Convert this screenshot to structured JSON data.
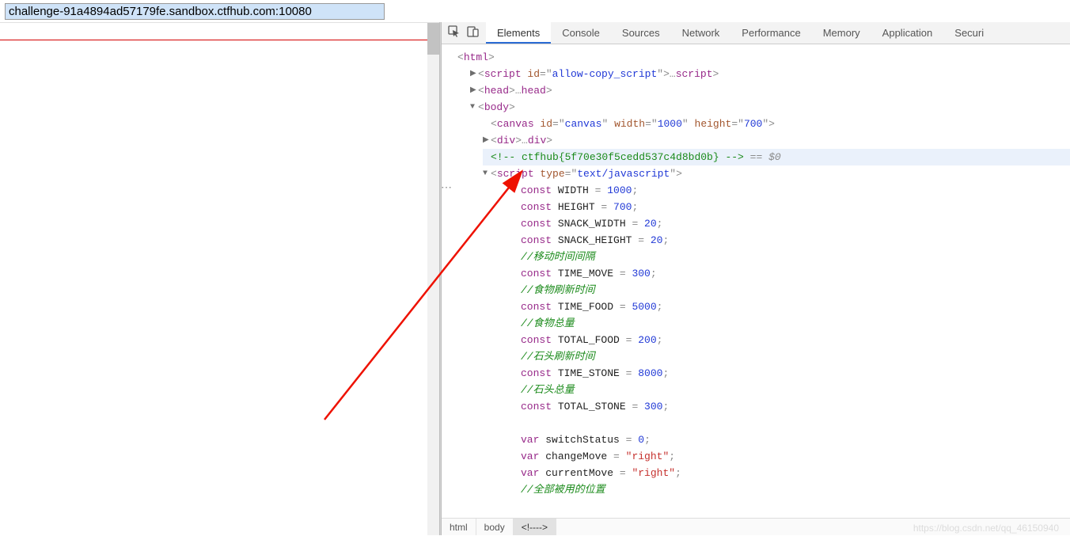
{
  "addr": "challenge-91a4894ad57179fe.sandbox.ctfhub.com:10080",
  "tabs": [
    "Elements",
    "Console",
    "Sources",
    "Network",
    "Performance",
    "Memory",
    "Application",
    "Securi"
  ],
  "activeTab": 0,
  "tree": {
    "html_open": {
      "tri": "",
      "punct_l": "<",
      "tag": "html",
      "punct_r": ">"
    },
    "script1": {
      "tri": "▶",
      "punct_l": "<",
      "tag": "script",
      "attr_id": " id",
      "eq": "=\"",
      "val_id": "allow-copy_script",
      "q": "\"",
      "punct_m": ">",
      "ell": "…",
      "close_l": "</",
      "tag2": "script",
      "close_r": ">"
    },
    "head": {
      "tri": "▶",
      "punct_l": "<",
      "tag": "head",
      "punct_m": ">",
      "ell": "…",
      "close_l": "</",
      "tag2": "head",
      "close_r": ">"
    },
    "body": {
      "tri": "▼",
      "punct_l": "<",
      "tag": "body",
      "punct_r": ">"
    },
    "canvas": {
      "punct_l": "<",
      "tag": "canvas",
      "a_id": " id",
      "eq1": "=\"",
      "v_id": "canvas",
      "q1": "\"",
      "a_w": " width",
      "eq2": "=\"",
      "v_w": "1000",
      "q2": "\"",
      "a_h": " height",
      "eq3": "=\"",
      "v_h": "700",
      "q3": "\"",
      "punct_r": ">"
    },
    "div": {
      "tri": "▶",
      "punct_l": "<",
      "tag": "div",
      "punct_m": ">",
      "ell": "…",
      "close_l": "</",
      "tag2": "div",
      "close_r": ">"
    },
    "comment": {
      "text": "<!-- ctfhub{5f70e30f5cedd537c4d8bd0b} -->",
      "suffix": " == $0"
    },
    "script2": {
      "tri": "▼",
      "punct_l": "<",
      "tag": "script",
      "a_t": " type",
      "eq": "=\"",
      "v_t": "text/javascript",
      "q": "\"",
      "punct_r": ">"
    },
    "code": [
      {
        "kw": "const ",
        "id": "WIDTH",
        "rest": " = ",
        "num": "1000",
        "semi": ";"
      },
      {
        "kw": "const ",
        "id": "HEIGHT",
        "rest": " = ",
        "num": "700",
        "semi": ";"
      },
      {
        "kw": "const ",
        "id": "SNACK_WIDTH",
        "rest": " = ",
        "num": "20",
        "semi": ";"
      },
      {
        "kw": "const ",
        "id": "SNACK_HEIGHT",
        "rest": " = ",
        "num": "20",
        "semi": ";"
      },
      {
        "cmnt": "//移动时间间隔"
      },
      {
        "kw": "const ",
        "id": "TIME_MOVE",
        "rest": " = ",
        "num": "300",
        "semi": ";"
      },
      {
        "cmnt": "//食物刷新时间"
      },
      {
        "kw": "const ",
        "id": "TIME_FOOD",
        "rest": " = ",
        "num": "5000",
        "semi": ";"
      },
      {
        "cmnt": "//食物总量"
      },
      {
        "kw": "const ",
        "id": "TOTAL_FOOD",
        "rest": " = ",
        "num": "200",
        "semi": ";"
      },
      {
        "cmnt": "//石头刷新时间"
      },
      {
        "kw": "const ",
        "id": "TIME_STONE",
        "rest": " = ",
        "num": "8000",
        "semi": ";"
      },
      {
        "cmnt": "//石头总量"
      },
      {
        "kw": "const ",
        "id": "TOTAL_STONE",
        "rest": " = ",
        "num": "300",
        "semi": ";"
      },
      {
        "blank": " "
      },
      {
        "kw": "var ",
        "id": "switchStatus",
        "rest": " = ",
        "num": "0",
        "semi": ";"
      },
      {
        "kw": "var ",
        "id": "changeMove",
        "rest": " = ",
        "str": "\"right\"",
        "semi": ";"
      },
      {
        "kw": "var ",
        "id": "currentMove",
        "rest": " = ",
        "str": "\"right\"",
        "semi": ";"
      },
      {
        "cmnt": "//全部被用的位置"
      }
    ]
  },
  "crumbs": [
    "html",
    "body",
    "<!---->"
  ],
  "watermark": "https://blog.csdn.net/qq_46150940"
}
